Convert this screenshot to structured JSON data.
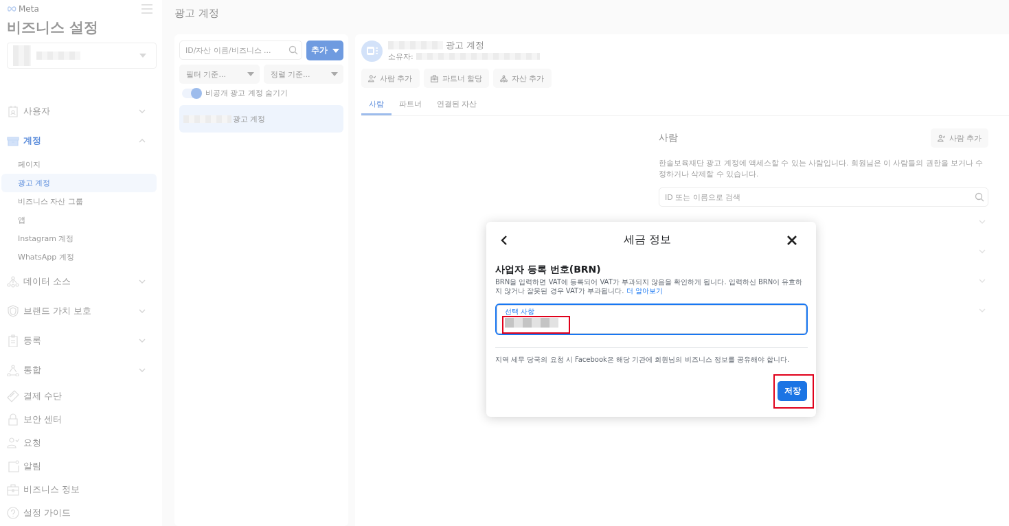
{
  "sidebar": {
    "logo": "Meta",
    "title": "비즈니스 설정",
    "items": [
      {
        "label": "사용자",
        "kind": "id-card",
        "selected": false,
        "expanded": false
      },
      {
        "label": "계정",
        "kind": "archive",
        "selected": true,
        "expanded": true,
        "children": [
          {
            "label": "페이지",
            "selected": false
          },
          {
            "label": "광고 계정",
            "selected": true
          },
          {
            "label": "비즈니스 자산 그룹",
            "selected": false
          },
          {
            "label": "앱",
            "selected": false
          },
          {
            "label": "Instagram 계정",
            "selected": false
          },
          {
            "label": "WhatsApp 계정",
            "selected": false
          }
        ]
      },
      {
        "label": "데이터 소스",
        "kind": "nodes",
        "selected": false,
        "expanded": false
      },
      {
        "label": "브랜드 가치 보호",
        "kind": "shield",
        "selected": false,
        "expanded": false
      },
      {
        "label": "등록",
        "kind": "clipboard",
        "selected": false,
        "expanded": false
      },
      {
        "label": "통합",
        "kind": "triangle",
        "selected": false,
        "expanded": false
      },
      {
        "label": "결제 수단",
        "kind": "card",
        "selected": false
      },
      {
        "label": "보안 센터",
        "kind": "lock",
        "selected": false
      },
      {
        "label": "요청",
        "kind": "person-check",
        "selected": false
      },
      {
        "label": "알림",
        "kind": "notification",
        "selected": false
      },
      {
        "label": "비즈니스 정보",
        "kind": "briefcase",
        "selected": false
      },
      {
        "label": "설정 가이드",
        "kind": "question",
        "selected": false
      }
    ]
  },
  "page_title": "광고 계정",
  "list_panel": {
    "search": {
      "placeholder": "ID/자산 이름/비즈니스 ..."
    },
    "add_button": "추가",
    "filters": [
      "필터 기준...",
      "정렬 기준..."
    ],
    "toggle": {
      "label": "비공개 광고 계정 숨기기",
      "on": true
    },
    "items": [
      {
        "label": "광고 계정",
        "selected": true
      }
    ]
  },
  "detail": {
    "title": "광고 계정",
    "owner_label": "소유자:",
    "actions": [
      {
        "label": "사람 추가",
        "kind": "person"
      },
      {
        "label": "파트너 할당",
        "kind": "briefcase"
      },
      {
        "label": "자산 추가",
        "kind": "nodes"
      }
    ],
    "tabs": [
      {
        "label": "사람",
        "selected": true
      },
      {
        "label": "파트너",
        "selected": false
      },
      {
        "label": "연결된 자산",
        "selected": false
      }
    ],
    "people": {
      "heading": "사람",
      "add_button": "사람 추가",
      "description": "한솔보육재단 광고 계정에 액세스할 수 있는 사람입니다. 회원님은 이 사람들의 권한을 보거나 수정하거나 삭제할 수 있습니다.",
      "search": {
        "placeholder": "ID 또는 이름으로 검색"
      },
      "rows": [
        {
          "expanded": false
        },
        {
          "expanded": false
        },
        {
          "expanded": false
        },
        {
          "expanded": false
        }
      ]
    }
  },
  "dialog": {
    "title": "세금 정보",
    "heading": "사업자 등록 번호(BRN)",
    "description": "BRN을 입력하면 VAT에 등록되어 VAT가 부과되지 않음을 확인하게 됩니다. 입력하신 BRN이 유효하지 않거나 잘못된 경우 VAT가 부과됩니다.",
    "link": "더 알아보기",
    "field": {
      "label": "선택 사항",
      "focused": true
    },
    "note": "지역 세무 당국의 요청 시 Facebook은 해당 기관에 회원님의 비즈니스 정보를 공유해야 합니다.",
    "save_button": "저장"
  }
}
